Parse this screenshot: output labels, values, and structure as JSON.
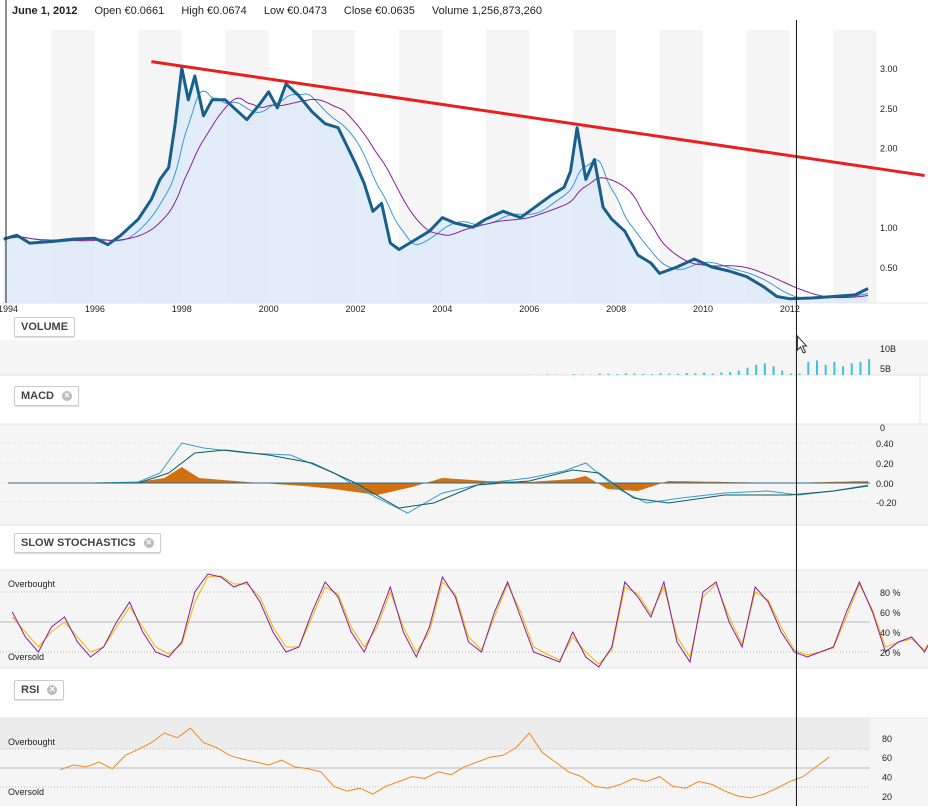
{
  "header": {
    "date": "June 1, 2012",
    "open_label": "Open",
    "open": "€0.0661",
    "high_label": "High",
    "high": "€0.0674",
    "low_label": "Low",
    "low": "€0.0473",
    "close_label": "Close",
    "close": "€0.0635",
    "volume_label": "Volume",
    "volume": "1,256,873,260"
  },
  "panels": {
    "volume": "VOLUME",
    "macd": "MACD",
    "stoch": "SLOW STOCHASTICS",
    "rsi": "RSI",
    "overbought": "Overbought",
    "oversold": "Oversold"
  },
  "colors": {
    "price": "#1a5f8a",
    "ma_short": "#3a9ad0",
    "ma_long": "#8a1f9a",
    "trend": "#e82020",
    "histogram": "#d07010",
    "volume": "#40c0e0",
    "stoch_k": "#8a1f9a",
    "stoch_d": "#f0b800",
    "rsi": "#f08a20"
  },
  "chart_data": [
    {
      "type": "line",
      "name": "price",
      "xlim": [
        1993.9,
        2013.8
      ],
      "ylim": [
        0,
        3.3
      ],
      "x_ticks": [
        "1994",
        "1996",
        "1998",
        "2000",
        "2002",
        "2004",
        "2006",
        "2008",
        "2010",
        "2012"
      ],
      "y_ticks": [
        "3.00",
        "2.50",
        "2.00",
        "1.00",
        "0.50"
      ],
      "series": [
        {
          "name": "Price",
          "points": [
            [
              1993.9,
              0.85
            ],
            [
              1994.2,
              0.9
            ],
            [
              1994.5,
              0.8
            ],
            [
              1995,
              0.82
            ],
            [
              1995.5,
              0.85
            ],
            [
              1996,
              0.86
            ],
            [
              1996.3,
              0.78
            ],
            [
              1996.6,
              0.9
            ],
            [
              1997,
              1.1
            ],
            [
              1997.3,
              1.35
            ],
            [
              1997.5,
              1.6
            ],
            [
              1997.7,
              1.75
            ],
            [
              1997.85,
              2.3
            ],
            [
              1998,
              3.0
            ],
            [
              1998.15,
              2.6
            ],
            [
              1998.3,
              2.9
            ],
            [
              1998.5,
              2.4
            ],
            [
              1998.7,
              2.6
            ],
            [
              1999,
              2.6
            ],
            [
              1999.3,
              2.45
            ],
            [
              1999.5,
              2.35
            ],
            [
              1999.8,
              2.55
            ],
            [
              2000,
              2.7
            ],
            [
              2000.2,
              2.5
            ],
            [
              2000.4,
              2.8
            ],
            [
              2000.7,
              2.65
            ],
            [
              2001,
              2.45
            ],
            [
              2001.3,
              2.3
            ],
            [
              2001.6,
              2.25
            ],
            [
              2002,
              1.8
            ],
            [
              2002.2,
              1.55
            ],
            [
              2002.4,
              1.2
            ],
            [
              2002.6,
              1.3
            ],
            [
              2002.8,
              0.8
            ],
            [
              2003,
              0.72
            ],
            [
              2003.4,
              0.85
            ],
            [
              2003.7,
              0.95
            ],
            [
              2004,
              1.12
            ],
            [
              2004.3,
              1.05
            ],
            [
              2004.7,
              1.0
            ],
            [
              2005,
              1.1
            ],
            [
              2005.4,
              1.2
            ],
            [
              2005.8,
              1.12
            ],
            [
              2006.2,
              1.28
            ],
            [
              2006.5,
              1.4
            ],
            [
              2006.8,
              1.5
            ],
            [
              2006.95,
              1.7
            ],
            [
              2007.1,
              2.25
            ],
            [
              2007.3,
              1.6
            ],
            [
              2007.5,
              1.85
            ],
            [
              2007.7,
              1.25
            ],
            [
              2007.9,
              1.1
            ],
            [
              2008.2,
              0.95
            ],
            [
              2008.5,
              0.65
            ],
            [
              2008.8,
              0.55
            ],
            [
              2009,
              0.42
            ],
            [
              2009.4,
              0.5
            ],
            [
              2009.8,
              0.6
            ],
            [
              2010.2,
              0.5
            ],
            [
              2010.6,
              0.45
            ],
            [
              2011,
              0.38
            ],
            [
              2011.4,
              0.25
            ],
            [
              2011.7,
              0.13
            ],
            [
              2012,
              0.1
            ],
            [
              2012.5,
              0.11
            ],
            [
              2013,
              0.13
            ],
            [
              2013.5,
              0.15
            ],
            [
              2013.8,
              0.23
            ]
          ]
        }
      ],
      "trendline": [
        [
          1997.3,
          3.08
        ],
        [
          2015.1,
          1.65
        ]
      ],
      "cursor_x": 2012.15
    },
    {
      "type": "bar",
      "name": "volume",
      "y_ticks": [
        "10B",
        "5B"
      ],
      "ylim": [
        0,
        12
      ],
      "x_start": 2006.0,
      "step": 0.2,
      "values": [
        0.1,
        0,
        0.2,
        0.1,
        0,
        0.3,
        0.2,
        0.1,
        0.5,
        0.4,
        0.3,
        0.6,
        0.5,
        0.4,
        0.3,
        0.6,
        0.5,
        0.4,
        0.7,
        0.6,
        0.8,
        0.5,
        0.9,
        1.0,
        1.5,
        2.5,
        3.5,
        4.0,
        3.0,
        1.5,
        0.5,
        0.5,
        4.5,
        5.0,
        3.5,
        4.5,
        3.0,
        4.0,
        4.5,
        5.5
      ]
    },
    {
      "type": "line",
      "name": "macd",
      "ylim": [
        -0.3,
        0.55
      ],
      "y_ticks": [
        "0",
        "0.40",
        "0.20",
        "0.00",
        "-0.20"
      ],
      "macd": [
        [
          1996,
          0
        ],
        [
          1997,
          0.01
        ],
        [
          1997.5,
          0.1
        ],
        [
          1998,
          0.4
        ],
        [
          1998.5,
          0.35
        ],
        [
          1999.5,
          0.3
        ],
        [
          2000.5,
          0.28
        ],
        [
          2001.5,
          0.1
        ],
        [
          2002.5,
          -0.15
        ],
        [
          2003.2,
          -0.3
        ],
        [
          2004,
          -0.1
        ],
        [
          2005,
          0.0
        ],
        [
          2006,
          0.05
        ],
        [
          2006.8,
          0.12
        ],
        [
          2007.3,
          0.2
        ],
        [
          2008,
          -0.05
        ],
        [
          2008.7,
          -0.2
        ],
        [
          2009.5,
          -0.15
        ],
        [
          2010.5,
          -0.1
        ],
        [
          2011.5,
          -0.08
        ],
        [
          2012.2,
          -0.12
        ],
        [
          2013,
          -0.08
        ],
        [
          2013.8,
          -0.02
        ]
      ],
      "signal": [
        [
          1996,
          0
        ],
        [
          1997,
          0.0
        ],
        [
          1997.7,
          0.1
        ],
        [
          1998.3,
          0.3
        ],
        [
          1999,
          0.33
        ],
        [
          2000,
          0.28
        ],
        [
          2001,
          0.2
        ],
        [
          2002,
          0.0
        ],
        [
          2003,
          -0.25
        ],
        [
          2003.8,
          -0.2
        ],
        [
          2004.8,
          -0.02
        ],
        [
          2006,
          0.02
        ],
        [
          2007,
          0.13
        ],
        [
          2007.6,
          0.1
        ],
        [
          2008.4,
          -0.15
        ],
        [
          2009.2,
          -0.2
        ],
        [
          2010.5,
          -0.12
        ],
        [
          2012,
          -0.12
        ],
        [
          2013,
          -0.08
        ],
        [
          2013.8,
          -0.03
        ]
      ],
      "hist": [
        [
          1996,
          0
        ],
        [
          1997,
          0.01
        ],
        [
          1997.6,
          0.05
        ],
        [
          1998,
          0.16
        ],
        [
          1998.4,
          0.05
        ],
        [
          1999.5,
          0.01
        ],
        [
          2000.8,
          -0.03
        ],
        [
          2001.5,
          -0.06
        ],
        [
          2002.5,
          -0.12
        ],
        [
          2003.3,
          -0.04
        ],
        [
          2004,
          0.05
        ],
        [
          2005,
          0.02
        ],
        [
          2006,
          0.01
        ],
        [
          2007,
          0.04
        ],
        [
          2007.3,
          0.07
        ],
        [
          2007.8,
          -0.06
        ],
        [
          2008.5,
          -0.08
        ],
        [
          2009.2,
          0.02
        ],
        [
          2010.5,
          0.01
        ],
        [
          2012,
          0.0
        ],
        [
          2013.8,
          0.02
        ]
      ]
    },
    {
      "type": "line",
      "name": "stochastics",
      "ylim": [
        0,
        100
      ],
      "y_ticks": [
        "80 %",
        "60 %",
        "40 %",
        "20 %"
      ],
      "x_start": 1994.1,
      "step": 0.3,
      "k": [
        60,
        35,
        20,
        45,
        55,
        30,
        15,
        25,
        50,
        70,
        40,
        20,
        15,
        30,
        80,
        98,
        95,
        85,
        90,
        70,
        40,
        20,
        25,
        60,
        90,
        75,
        40,
        20,
        50,
        85,
        40,
        15,
        45,
        95,
        75,
        30,
        20,
        60,
        90,
        55,
        20,
        15,
        10,
        40,
        15,
        5,
        25,
        90,
        75,
        55,
        90,
        30,
        10,
        80,
        90,
        50,
        25,
        85,
        70,
        40,
        20,
        15,
        20,
        25,
        60,
        90,
        60,
        20,
        30,
        35,
        20,
        45,
        15,
        10,
        20,
        50,
        65,
        75,
        70,
        55,
        85,
        90
      ],
      "d": [
        55,
        40,
        25,
        40,
        50,
        35,
        20,
        25,
        45,
        65,
        45,
        25,
        18,
        28,
        70,
        95,
        96,
        88,
        88,
        75,
        45,
        25,
        25,
        55,
        85,
        78,
        45,
        25,
        45,
        80,
        45,
        20,
        40,
        90,
        78,
        35,
        22,
        55,
        88,
        60,
        25,
        18,
        12,
        35,
        20,
        8,
        22,
        85,
        78,
        58,
        85,
        35,
        15,
        75,
        88,
        55,
        28,
        80,
        72,
        45,
        22,
        17,
        20,
        24,
        55,
        88,
        62,
        25,
        30,
        33,
        22,
        42,
        18,
        12,
        18,
        45,
        62,
        73,
        70,
        57,
        82,
        88
      ]
    },
    {
      "type": "line",
      "name": "rsi",
      "ylim": [
        10,
        100
      ],
      "y_ticks": [
        "80",
        "60",
        "40",
        "20"
      ],
      "x_start": 1995.2,
      "step": 0.3,
      "values": [
        47,
        52,
        50,
        55,
        48,
        62,
        68,
        75,
        85,
        80,
        90,
        75,
        70,
        62,
        58,
        55,
        52,
        57,
        50,
        48,
        45,
        30,
        25,
        28,
        22,
        30,
        35,
        40,
        38,
        45,
        42,
        50,
        55,
        60,
        62,
        70,
        85,
        65,
        55,
        45,
        40,
        30,
        28,
        32,
        38,
        35,
        40,
        30,
        28,
        35,
        32,
        25,
        20,
        18,
        22,
        28,
        35,
        40,
        50,
        60
      ]
    }
  ]
}
